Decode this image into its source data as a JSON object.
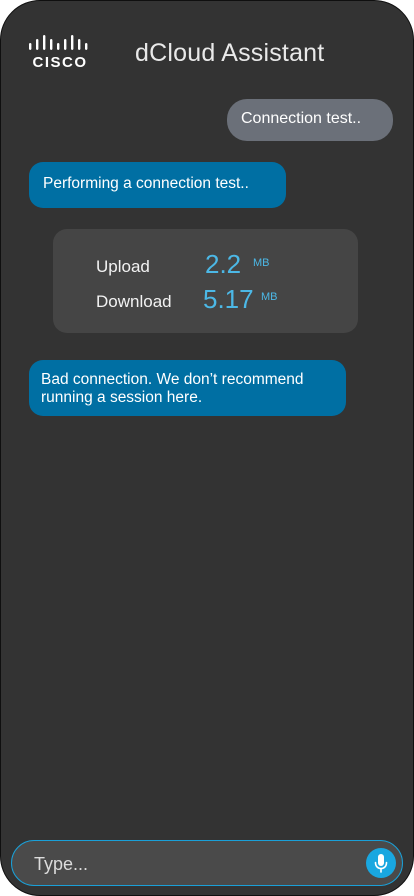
{
  "header": {
    "logo_text": "CISCO",
    "title": "dCloud Assistant"
  },
  "messages": {
    "user_message": "Connection test..",
    "bot_status": "Performing a connection test..",
    "bot_result": "Bad connection. We don’t recommend running a session here."
  },
  "speed_test": {
    "upload_label": "Upload",
    "upload_value": "2.2",
    "upload_unit": "MB",
    "download_label": "Download",
    "download_value": "5.17",
    "download_unit": "MB"
  },
  "composer": {
    "placeholder": "Type..."
  },
  "icons": {
    "logo": "cisco-logo-icon",
    "mic": "microphone-icon"
  },
  "colors": {
    "background": "#333333",
    "bot_bubble": "#006fa3",
    "user_bubble": "#6b7079",
    "accent": "#19a7e0",
    "metric_value": "#4cb8e6"
  }
}
